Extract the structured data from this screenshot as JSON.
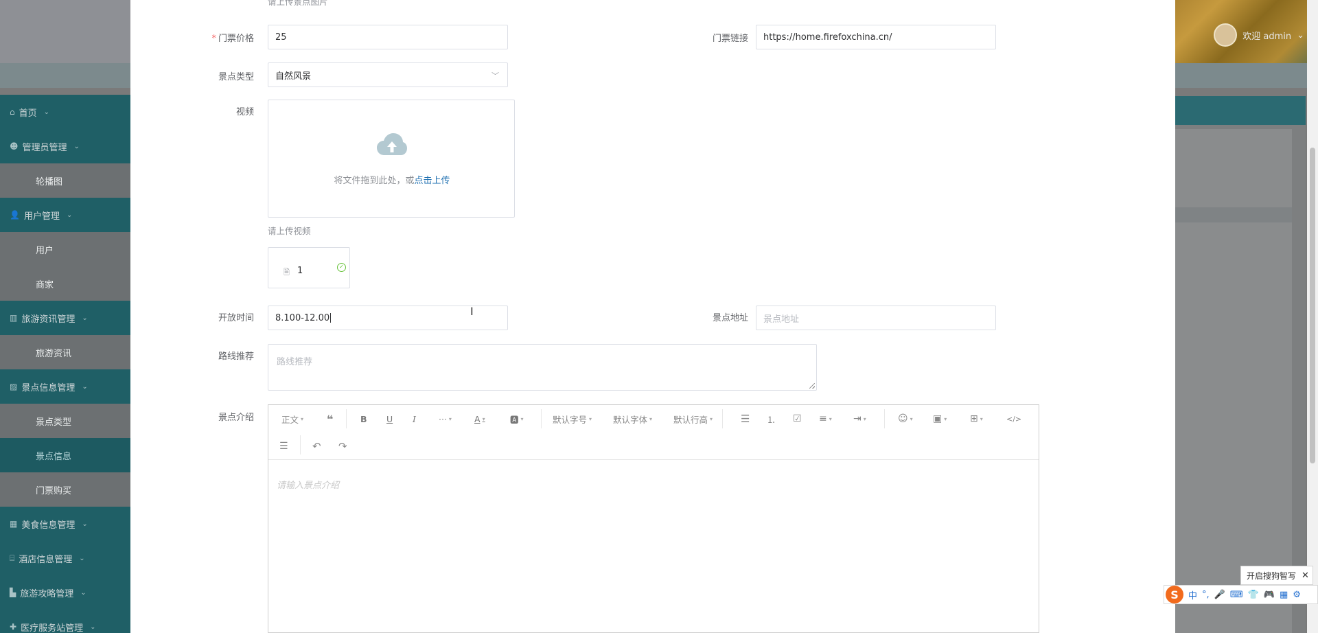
{
  "header": {
    "welcome": "欢迎 admin"
  },
  "sidebar": {
    "items": [
      {
        "label": "首页",
        "type": "group",
        "icon": "home-icon"
      },
      {
        "label": "管理员管理",
        "type": "group",
        "icon": "admin-icon"
      },
      {
        "label": "轮播图",
        "type": "sub"
      },
      {
        "label": "用户管理",
        "type": "group",
        "icon": "user-icon"
      },
      {
        "label": "用户",
        "type": "sub"
      },
      {
        "label": "商家",
        "type": "sub"
      },
      {
        "label": "旅游资讯管理",
        "type": "group",
        "icon": "news-icon"
      },
      {
        "label": "旅游资讯",
        "type": "sub"
      },
      {
        "label": "景点信息管理",
        "type": "group",
        "icon": "image-icon"
      },
      {
        "label": "景点类型",
        "type": "sub"
      },
      {
        "label": "景点信息",
        "type": "sub",
        "active": true
      },
      {
        "label": "门票购买",
        "type": "sub"
      },
      {
        "label": "美食信息管理",
        "type": "group",
        "icon": "grid-icon"
      },
      {
        "label": "酒店信息管理",
        "type": "group",
        "icon": "hotel-icon"
      },
      {
        "label": "旅游攻略管理",
        "type": "group",
        "icon": "guide-icon"
      },
      {
        "label": "医疗服务站管理",
        "type": "group",
        "icon": "medical-icon"
      }
    ]
  },
  "form": {
    "top_hint": "请上传景点图片",
    "price": {
      "label": "门票价格",
      "value": "25",
      "required": true
    },
    "ticket_link": {
      "label": "门票链接",
      "value": "https://home.firefoxchina.cn/"
    },
    "type": {
      "label": "景点类型",
      "value": "自然风景"
    },
    "video": {
      "label": "视频",
      "upload_text": "将文件拖到此处，或",
      "upload_link": "点击上传",
      "hint": "请上传视频",
      "file_name": "1"
    },
    "open_time": {
      "label": "开放时间",
      "value": "8.100-12.00"
    },
    "address": {
      "label": "景点地址",
      "placeholder": "景点地址"
    },
    "route": {
      "label": "路线推荐",
      "placeholder": "路线推荐"
    },
    "intro": {
      "label": "景点介绍",
      "placeholder": "请输入景点介绍"
    }
  },
  "editor": {
    "toolbar": {
      "heading": "正文",
      "font_size": "默认字号",
      "font_family": "默认字体",
      "line_height": "默认行高",
      "more": "···",
      "font_color": "A"
    }
  },
  "ime": {
    "tip": "开启搜狗智写",
    "close": "✕",
    "logo": "S",
    "mode": "中"
  },
  "colors": {
    "sidebar_group": "#1f5f66",
    "link": "#1e6fb0",
    "required": "#f56c6c",
    "success": "#67c23a"
  }
}
